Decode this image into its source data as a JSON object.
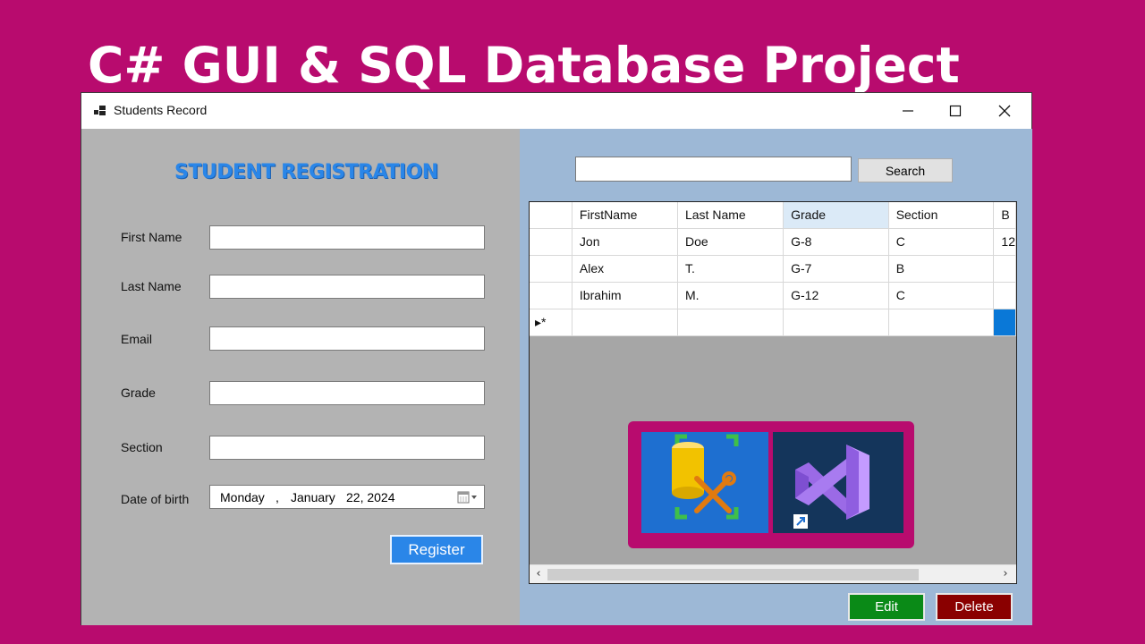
{
  "banner": {
    "title": "C# GUI & SQL Database Project"
  },
  "window": {
    "title": "Students Record",
    "controls": [
      "minimize-icon",
      "maximize-icon",
      "close-icon"
    ]
  },
  "form": {
    "heading": "STUDENT REGISTRATION",
    "fields": [
      {
        "label": "First Name",
        "value": ""
      },
      {
        "label": "Last Name",
        "value": ""
      },
      {
        "label": "Email",
        "value": ""
      },
      {
        "label": "Grade",
        "value": ""
      },
      {
        "label": "Section",
        "value": ""
      }
    ],
    "dob": {
      "label": "Date of birth",
      "weekday": "Monday",
      "sep": ",",
      "month": "January",
      "day_year": "22, 2024"
    },
    "register_label": "Register"
  },
  "search": {
    "value": "",
    "button_label": "Search"
  },
  "grid": {
    "columns": [
      "FirstName",
      "Last Name",
      "Grade",
      "Section",
      "B"
    ],
    "selected_column": "Grade",
    "rows": [
      [
        "Jon",
        "Doe",
        "G-8",
        "C",
        "12"
      ],
      [
        "Alex",
        "T.",
        "G-7",
        "B",
        ""
      ],
      [
        "Ibrahim",
        "M.",
        "G-12",
        "C",
        ""
      ]
    ],
    "new_row_marker": "▸*"
  },
  "logos": [
    "sql-server-tools-icon",
    "visual-studio-icon"
  ],
  "actions": {
    "edit_label": "Edit",
    "delete_label": "Delete"
  },
  "colors": {
    "background": "#b80b6e",
    "accent_blue": "#2a86e8",
    "edit_green": "#0a8a17",
    "delete_red": "#8a0000"
  }
}
